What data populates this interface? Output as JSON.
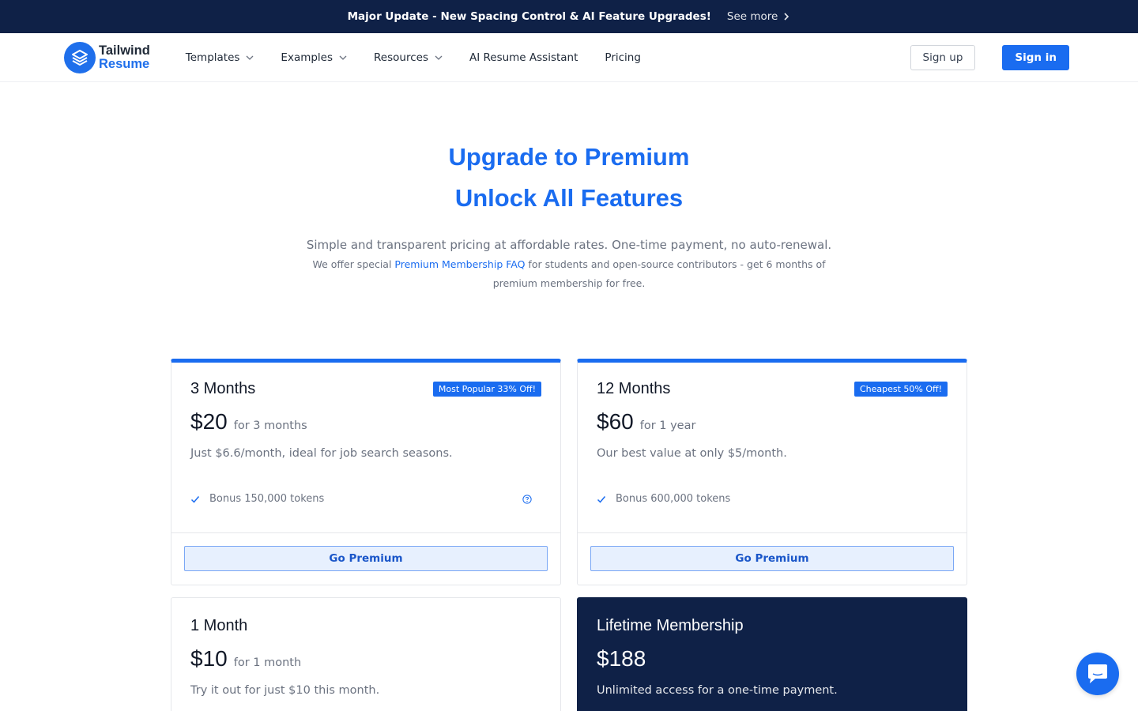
{
  "banner": {
    "text": "Major Update - New Spacing Control & AI Feature Upgrades!",
    "link": "See more"
  },
  "logo": {
    "line1": "Tailwind",
    "line2": "Resume"
  },
  "nav": {
    "items": [
      {
        "label": "Templates",
        "dropdown": true
      },
      {
        "label": "Examples",
        "dropdown": true
      },
      {
        "label": "Resources",
        "dropdown": true
      },
      {
        "label": "AI Resume Assistant",
        "dropdown": false
      },
      {
        "label": "Pricing",
        "dropdown": false
      }
    ],
    "signup": "Sign up",
    "signin": "Sign in"
  },
  "hero": {
    "title1": "Upgrade to Premium",
    "title2": "Unlock All Features",
    "subtitle": "Simple and transparent pricing at affordable rates. One-time payment, no auto-renewal.",
    "note_before": "We offer special ",
    "note_link": "Premium Membership FAQ",
    "note_after": " for students and open-source contributors - get 6 months of premium membership for free."
  },
  "plans": [
    {
      "title": "3 Months",
      "badge": "Most Popular 33% Off!",
      "price": "$20",
      "period": "for 3 months",
      "description": "Just $6.6/month, ideal for job search seasons.",
      "feature": "Bonus 150,000 tokens",
      "button": "Go Premium"
    },
    {
      "title": "12 Months",
      "badge": "Cheapest 50% Off!",
      "price": "$60",
      "period": "for 1 year",
      "description": "Our best value at only $5/month.",
      "feature": "Bonus 600,000 tokens",
      "button": "Go Premium"
    },
    {
      "title": "1 Month",
      "price": "$10",
      "period": "for 1 month",
      "description": "Try it out for just $10 this month."
    },
    {
      "title": "Lifetime Membership",
      "price": "$188",
      "description": "Unlimited access for a one-time payment."
    }
  ],
  "colors": {
    "brand": "#1a6cf0",
    "navy": "#0f2147"
  },
  "icons": {
    "chevron": "chevron-right-icon",
    "dropdown": "chevron-down-icon",
    "check": "check-icon",
    "help": "question-circle-icon",
    "chat": "chat-icon"
  }
}
